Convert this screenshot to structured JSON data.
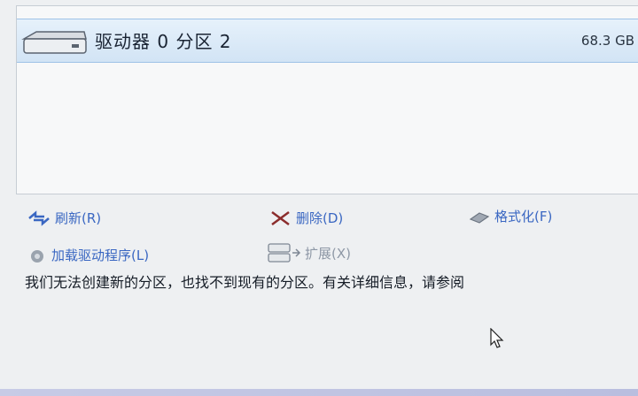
{
  "partition_list": {
    "rows": [
      {
        "icon": "hard-drive-icon",
        "name": "驱动器 0 分区 2",
        "size": "68.3 GB"
      }
    ]
  },
  "actions": {
    "refresh": {
      "label": "刷新(R)",
      "icon": "refresh-icon"
    },
    "delete": {
      "label": "删除(D)",
      "icon": "delete-x-icon"
    },
    "format": {
      "label": "格式化(F)",
      "icon": "format-eraser-icon"
    },
    "load_driver": {
      "label": "加载驱动程序(L)",
      "icon": "load-driver-icon"
    },
    "extend": {
      "label": "扩展(X)",
      "icon": "extend-icon"
    }
  },
  "message": "我们无法创建新的分区，也找不到现有的分区。有关详细信息，请参阅",
  "colors": {
    "selection": "#d2e4f5",
    "link": "#3a67c2",
    "disabled": "#8e98a6"
  }
}
